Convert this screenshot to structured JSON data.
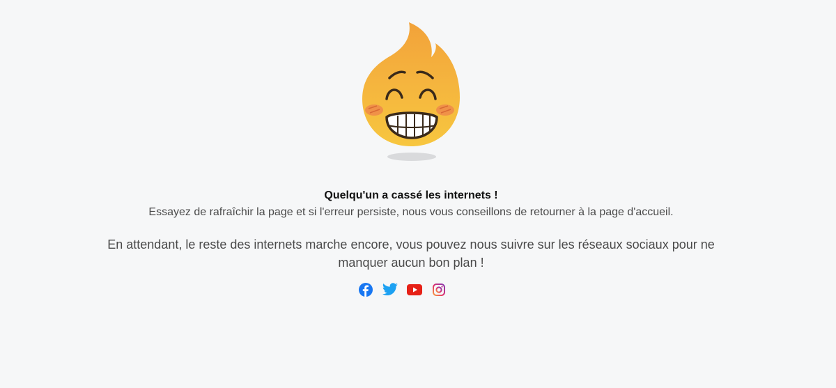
{
  "error": {
    "title": "Quelqu'un a cassé les internets !",
    "subtitle": "Essayez de rafraîchir la page et si l'erreur persiste, nous vous conseillons de retourner à la page d'accueil.",
    "meanwhile": "En attendant, le reste des internets marche encore, vous pouvez nous suivre sur les réseaux sociaux pour ne manquer aucun bon plan !"
  },
  "mascot": {
    "icon": "flame-smiley-icon",
    "colors": {
      "flame_top": "#f3a63a",
      "face": "#f6c23e",
      "blush": "#ef8a4a",
      "outline": "#3a2a1a",
      "shadow": "#d9dadc"
    }
  },
  "socials": [
    {
      "name": "facebook",
      "icon": "facebook-icon",
      "color": "#1877f2"
    },
    {
      "name": "twitter",
      "icon": "twitter-icon",
      "color": "#1da1f2"
    },
    {
      "name": "youtube",
      "icon": "youtube-icon",
      "color": "#e62117"
    },
    {
      "name": "instagram",
      "icon": "instagram-icon",
      "color": "#c13584"
    }
  ]
}
